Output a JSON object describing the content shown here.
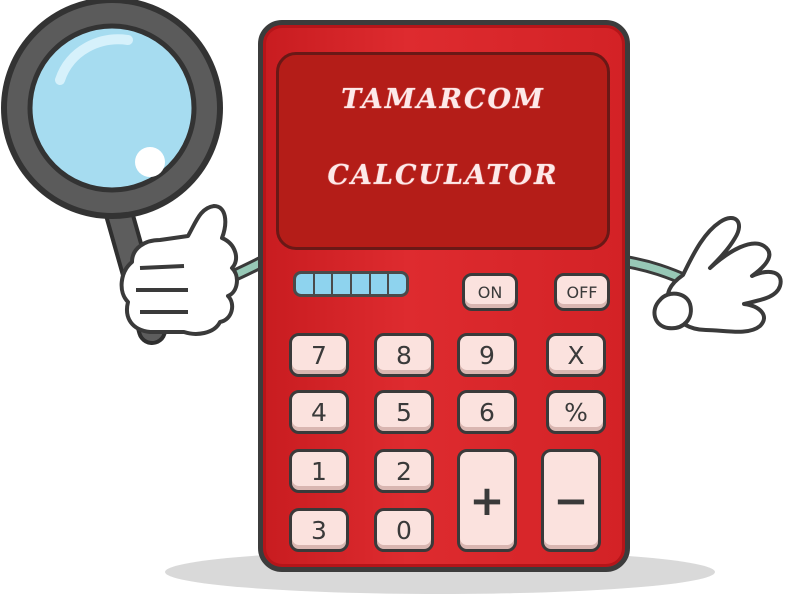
{
  "calculator": {
    "title_line_1": "TAMARCOM",
    "title_line_2": "CALCULATOR"
  },
  "keys": {
    "on": "ON",
    "off": "OFF",
    "seven": "7",
    "eight": "8",
    "nine": "9",
    "multiply": "X",
    "four": "4",
    "five": "5",
    "six": "6",
    "percent": "%",
    "one": "1",
    "two": "2",
    "three": "3",
    "zero": "0",
    "plus": "+",
    "minus": "−"
  },
  "colors": {
    "body": "#d32226",
    "screen": "#b41d18",
    "key": "#fbe2de",
    "lens": "#a6dcf0"
  }
}
